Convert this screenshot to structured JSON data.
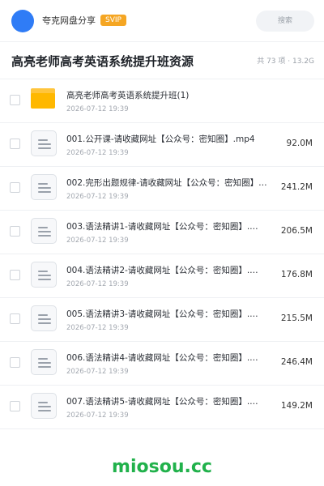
{
  "app": {
    "name": "夸克网盘分享",
    "badge": "SVIP"
  },
  "search": {
    "placeholder": "搜索"
  },
  "header": {
    "title": "高亮老师高考英语系统提升班资源",
    "summary": "共 73 项 · 13.2G"
  },
  "files": [
    {
      "type": "folder",
      "name": "高亮老师高考英语系统提升班(1)",
      "date": "2026-07-12 19:39",
      "size": ""
    },
    {
      "type": "file",
      "name": "001.公开课-请收藏网址【公众号：密知圈】.mp4",
      "date": "2026-07-12 19:39",
      "size": "92.0M"
    },
    {
      "type": "file",
      "name": "002.完形出题规律-请收藏网址【公众号：密知圈】…",
      "date": "2026-07-12 19:39",
      "size": "241.2M"
    },
    {
      "type": "file",
      "name": "003.语法精讲1-请收藏网址【公众号：密知圈】.…",
      "date": "2026-07-12 19:39",
      "size": "206.5M"
    },
    {
      "type": "file",
      "name": "004.语法精讲2-请收藏网址【公众号：密知圈】.…",
      "date": "2026-07-12 19:39",
      "size": "176.8M"
    },
    {
      "type": "file",
      "name": "005.语法精讲3-请收藏网址【公众号：密知圈】.…",
      "date": "2026-07-12 19:39",
      "size": "215.5M"
    },
    {
      "type": "file",
      "name": "006.语法精讲4-请收藏网址【公众号：密知圈】.…",
      "date": "2026-07-12 19:39",
      "size": "246.4M"
    },
    {
      "type": "file",
      "name": "007.语法精讲5-请收藏网址【公众号：密知圈】.…",
      "date": "2026-07-12 19:39",
      "size": "149.2M"
    }
  ],
  "watermark": "miosou.cc",
  "colors": {
    "accent": "#2f7cf6",
    "svip": "#f5a623",
    "folder": "#ffb800",
    "watermark": "#21b14b"
  }
}
